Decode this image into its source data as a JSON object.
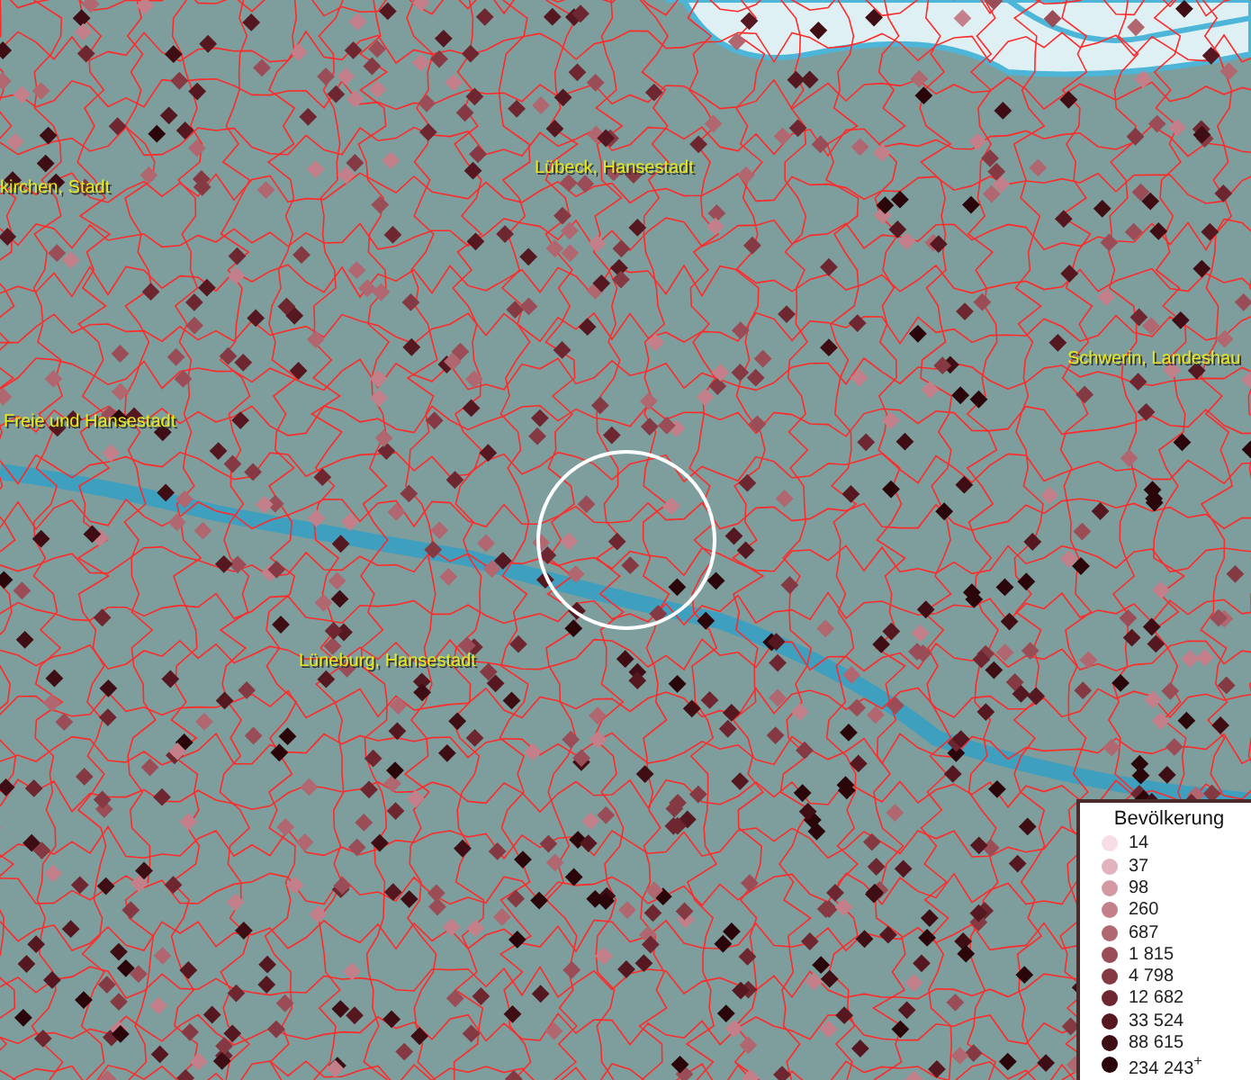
{
  "map": {
    "places": [
      {
        "name": "kirchen, Stadt"
      },
      {
        "name": "Lübeck, Hansestadt"
      },
      {
        "name": "Freie und Hansestadt"
      },
      {
        "name": "Schwerin, Landeshau"
      },
      {
        "name": "Lüneburg, Hansestadt"
      }
    ]
  },
  "legend": {
    "title": "Bevölkerung",
    "classes": [
      {
        "label": "14",
        "color": "#f6dde6"
      },
      {
        "label": "37",
        "color": "#e0b3bd"
      },
      {
        "label": "98",
        "color": "#d39aa3"
      },
      {
        "label": "260",
        "color": "#c4808a"
      },
      {
        "label": "687",
        "color": "#b06770"
      },
      {
        "label": "1 815",
        "color": "#9a4d56"
      },
      {
        "label": "4 798",
        "color": "#853a43"
      },
      {
        "label": "12 682",
        "color": "#6e2730"
      },
      {
        "label": "33 524",
        "color": "#561820"
      },
      {
        "label": "88 615",
        "color": "#3f0d14"
      },
      {
        "label": "234 243$^{+}$",
        "color": "#2a050a"
      }
    ]
  }
}
